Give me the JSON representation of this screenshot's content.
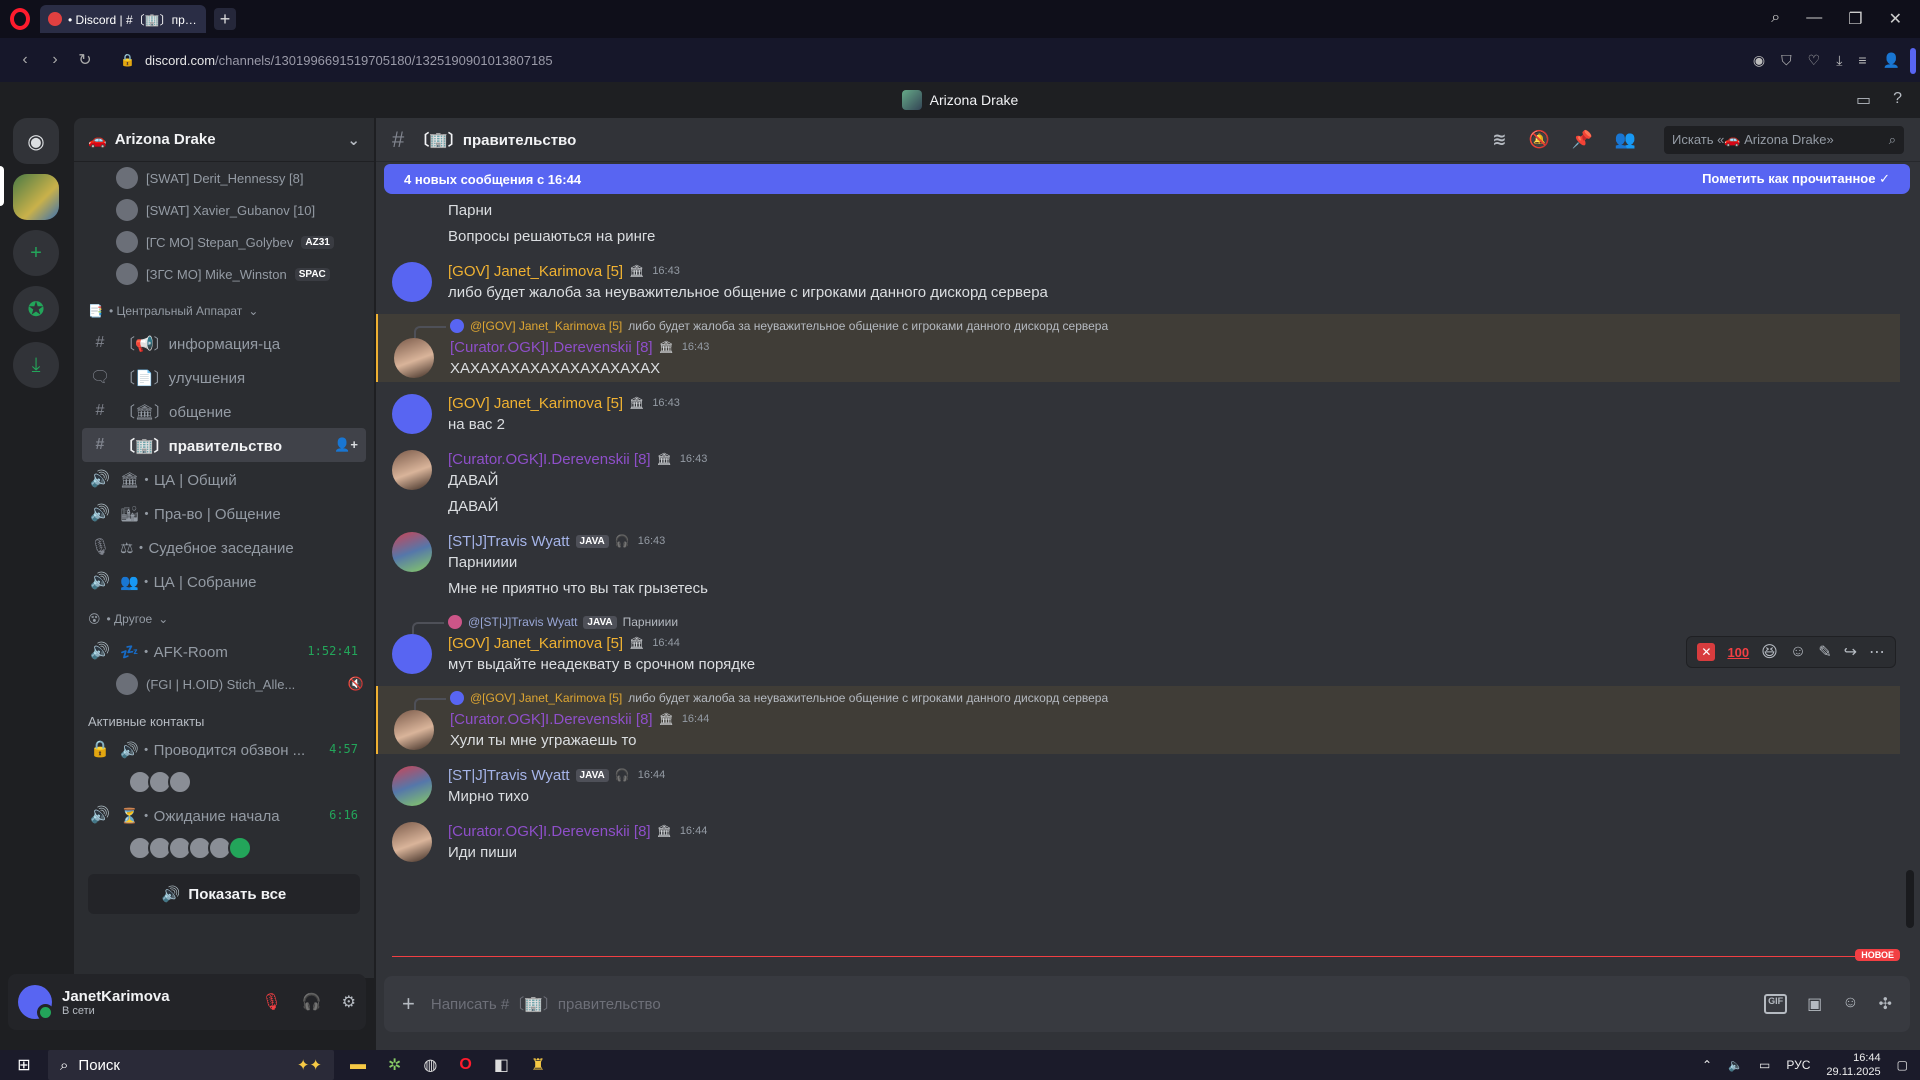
{
  "browser": {
    "tab_title": "• Discord | #〔🏢〕правите",
    "url_host": "discord.com",
    "url_path": "/channels/1301996691519705180/1325190901013807185"
  },
  "app_title": "Arizona Drake",
  "server": {
    "name": "Arizona Drake"
  },
  "sidebar": {
    "voice_users_top": [
      {
        "name": "[SWAT] Derit_Hennessy [8]",
        "tag": ""
      },
      {
        "name": "[SWAT] Xavier_Gubanov [10]",
        "tag": ""
      },
      {
        "name": "[ГС МО] Stepan_Golybev",
        "tag": "AZ31"
      },
      {
        "name": "[ЗГС МО] Mike_Winston",
        "tag": "SPAC"
      }
    ],
    "category_central": "• Центральный Аппарат",
    "channels_central": [
      {
        "icon": "#",
        "name": "〔📢〕информация-ца",
        "active": false
      },
      {
        "icon": "🗨",
        "name": "〔📄〕улучшения",
        "active": false
      },
      {
        "icon": "#",
        "name": "〔🏛〕общение",
        "active": false
      },
      {
        "icon": "#",
        "name": "〔🏢〕правительство",
        "active": true
      },
      {
        "icon": "🔊",
        "name": "🏛・ЦА | Общий",
        "active": false
      },
      {
        "icon": "🔊",
        "name": "🏙・Пра-во | Общение",
        "active": false
      },
      {
        "icon": "🎙",
        "name": "⚖・Судебное заседание",
        "active": false
      },
      {
        "icon": "🔊",
        "name": "👥・ЦА | Собрание",
        "active": false
      }
    ],
    "category_other": "• Другое",
    "afk_channel": {
      "name": "💤・AFK-Room",
      "timer": "1:52:41"
    },
    "afk_user": "(FGI | H.OID) Stich_Alle...",
    "active_contacts_label": "Активные контакты",
    "active_calls": [
      {
        "name": "🔊・Проводится обзвон ...",
        "timer": "4:57"
      },
      {
        "name": "⏳・Ожидание начала",
        "timer": "6:16"
      }
    ],
    "show_all": "Показать все"
  },
  "user": {
    "name": "JanetKarimova",
    "status": "В сети"
  },
  "chat": {
    "channel_name": "〔🏢〕правительство",
    "search_placeholder": "Искать «🚗 Arizona Drake»",
    "new_messages_banner": "4 новых сообщения с 16:44",
    "mark_read": "Пометить как прочитанное",
    "new_label": "НОВОЕ",
    "composer_placeholder": "Написать #〔🏢〕правительство",
    "messages": [
      {
        "kind": "cont",
        "text": "Парни"
      },
      {
        "kind": "cont",
        "text": "Вопросы решаються на ринге"
      },
      {
        "kind": "full",
        "author": "[GOV] Janet_Karimova [5]",
        "role": "gov",
        "time": "16:43",
        "text": "либо будет жалоба за неуважительное общение с игроками данного дискорд сервера"
      },
      {
        "kind": "full",
        "author": "[Curator.OGK]I.Derevenskii [8]",
        "role": "curator",
        "time": "16:43",
        "text": "ХАХАХАХАХАХАХАХАХАХАХ",
        "reply_author": "@[GOV] Janet_Karimova [5]",
        "reply_text": "либо будет жалоба за неуважительное общение с игроками данного дискорд сервера",
        "mention": true
      },
      {
        "kind": "full",
        "author": "[GOV] Janet_Karimova [5]",
        "role": "gov",
        "time": "16:43",
        "text": "на вас 2"
      },
      {
        "kind": "full",
        "author": "[Curator.OGK]I.Derevenskii [8]",
        "role": "curator",
        "time": "16:43",
        "text": "ДАВАЙ"
      },
      {
        "kind": "cont",
        "text": "ДАВАЙ"
      },
      {
        "kind": "full",
        "author": "[ST|J]Travis Wyatt",
        "role": "travis",
        "tag": "JAVA",
        "time": "16:43",
        "text": "Парнииии"
      },
      {
        "kind": "cont",
        "text": "Мне не приятно что вы так грызетесь"
      },
      {
        "kind": "full",
        "author": "[GOV] Janet_Karimova [5]",
        "role": "gov",
        "time": "16:44",
        "text": "мут выдайте неадеквату в срочном порядке",
        "reply_author": "@[ST|J]Travis Wyatt",
        "reply_tag": "JAVA",
        "reply_text": "Парнииии"
      },
      {
        "kind": "full",
        "author": "[Curator.OGK]I.Derevenskii [8]",
        "role": "curator",
        "time": "16:44",
        "text": "Хули ты мне угражаешь то",
        "reply_author": "@[GOV] Janet_Karimova [5]",
        "reply_text": "либо будет жалоба за неуважительное общение с игроками данного дискорд сервера",
        "mention": true
      },
      {
        "kind": "full",
        "author": "[ST|J]Travis Wyatt",
        "role": "travis",
        "tag": "JAVA",
        "time": "16:44",
        "text": "Мирно тихо"
      },
      {
        "kind": "full",
        "author": "[Curator.OGK]I.Derevenskii [8]",
        "role": "curator",
        "time": "16:44",
        "text": "Иди пиши"
      }
    ]
  },
  "taskbar": {
    "search_label": "Поиск",
    "lang": "РУС",
    "time": "16:44",
    "date": "29.11.2025"
  }
}
